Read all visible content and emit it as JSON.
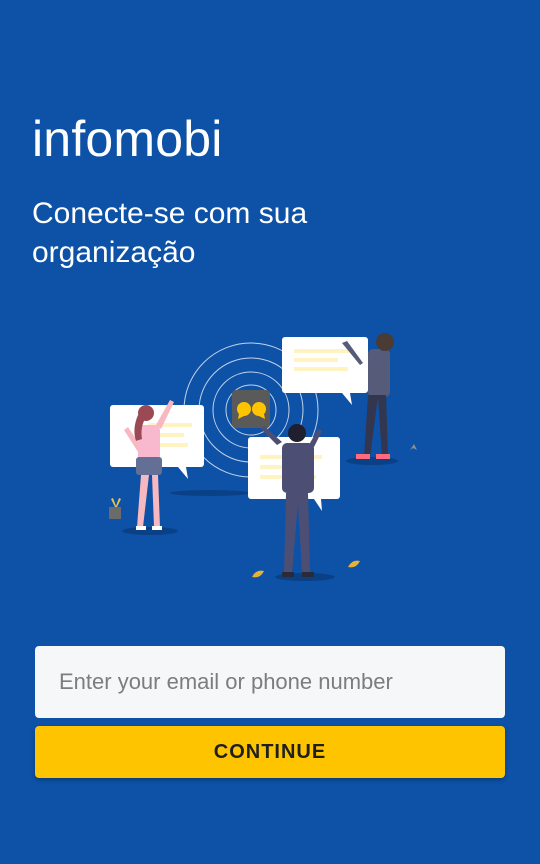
{
  "app": {
    "title": "infomobi",
    "subtitle": "Conecte-se com sua organização"
  },
  "illustration": {
    "icon": "people-collaborating-with-chat-bubbles-illustration",
    "logo_icon": "speech-bubbles-logo-icon"
  },
  "login_form": {
    "email_placeholder": "Enter your email or phone number",
    "email_value": "",
    "continue_label": "CONTINUE"
  },
  "colors": {
    "background": "#0d52a7",
    "button": "#fec400",
    "input_background": "#f5f7f8",
    "text_light": "#ffffff"
  }
}
